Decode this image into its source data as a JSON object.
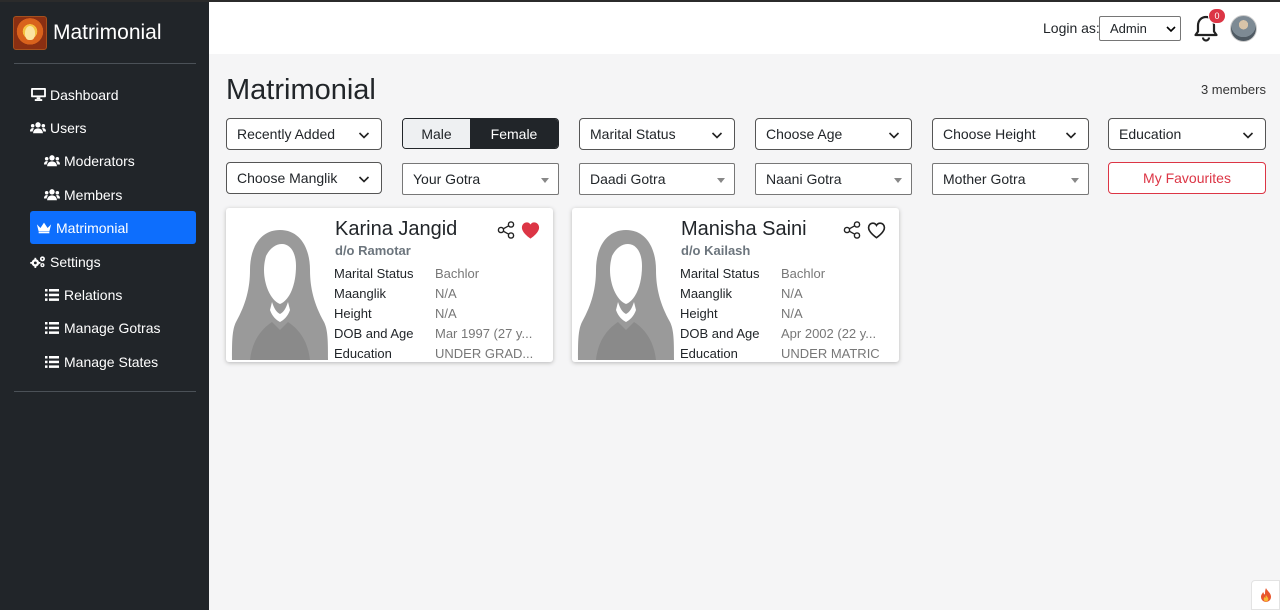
{
  "app": {
    "title": "Matrimonial"
  },
  "sidebar": {
    "items": [
      {
        "label": "Dashboard",
        "icon": "monitor-icon"
      },
      {
        "label": "Users",
        "icon": "users-icon"
      },
      {
        "label": "Moderators",
        "icon": "users-icon"
      },
      {
        "label": "Members",
        "icon": "users-icon"
      },
      {
        "label": "Matrimonial",
        "icon": "crown-icon",
        "active": true
      },
      {
        "label": "Settings",
        "icon": "gears-icon"
      },
      {
        "label": "Relations",
        "icon": "list-icon"
      },
      {
        "label": "Manage Gotras",
        "icon": "list-icon"
      },
      {
        "label": "Manage States",
        "icon": "list-icon"
      }
    ]
  },
  "header": {
    "login_label": "Login as:",
    "role_value": "Admin",
    "notification_count": "0"
  },
  "main": {
    "title": "Matrimonial",
    "member_count": "3 members",
    "filters": {
      "sort": "Recently Added",
      "gender_male": "Male",
      "gender_female": "Female",
      "gender_selected": "Female",
      "marital_status": "Marital Status",
      "age": "Choose Age",
      "height": "Choose Height",
      "education": "Education",
      "manglik": "Choose Manglik",
      "your_gotra": "Your Gotra",
      "daadi_gotra": "Daadi Gotra",
      "naani_gotra": "Naani Gotra",
      "mother_gotra": "Mother Gotra",
      "favourites": "My Favourites"
    },
    "field_labels": {
      "marital_status": "Marital Status",
      "manglik": "Maanglik",
      "height": "Height",
      "dob_age": "DOB and Age",
      "education": "Education"
    },
    "profiles": [
      {
        "name": "Karina Jangid",
        "parent": "d/o Ramotar",
        "marital_status": "Bachlor",
        "manglik": "N/A",
        "height": "N/A",
        "dob_age": "Mar 1997 (27 y...",
        "education": "UNDER GRAD...",
        "favourite": true
      },
      {
        "name": "Manisha Saini",
        "parent": "d/o Kailash",
        "marital_status": "Bachlor",
        "manglik": "N/A",
        "height": "N/A",
        "dob_age": "Apr 2002 (22 y...",
        "education": "UNDER MATRIC",
        "favourite": false
      }
    ]
  },
  "colors": {
    "sidebar_bg": "#212529",
    "active_blue": "#0d6efd",
    "danger_red": "#dc3545",
    "page_bg": "#f5f5f6"
  }
}
